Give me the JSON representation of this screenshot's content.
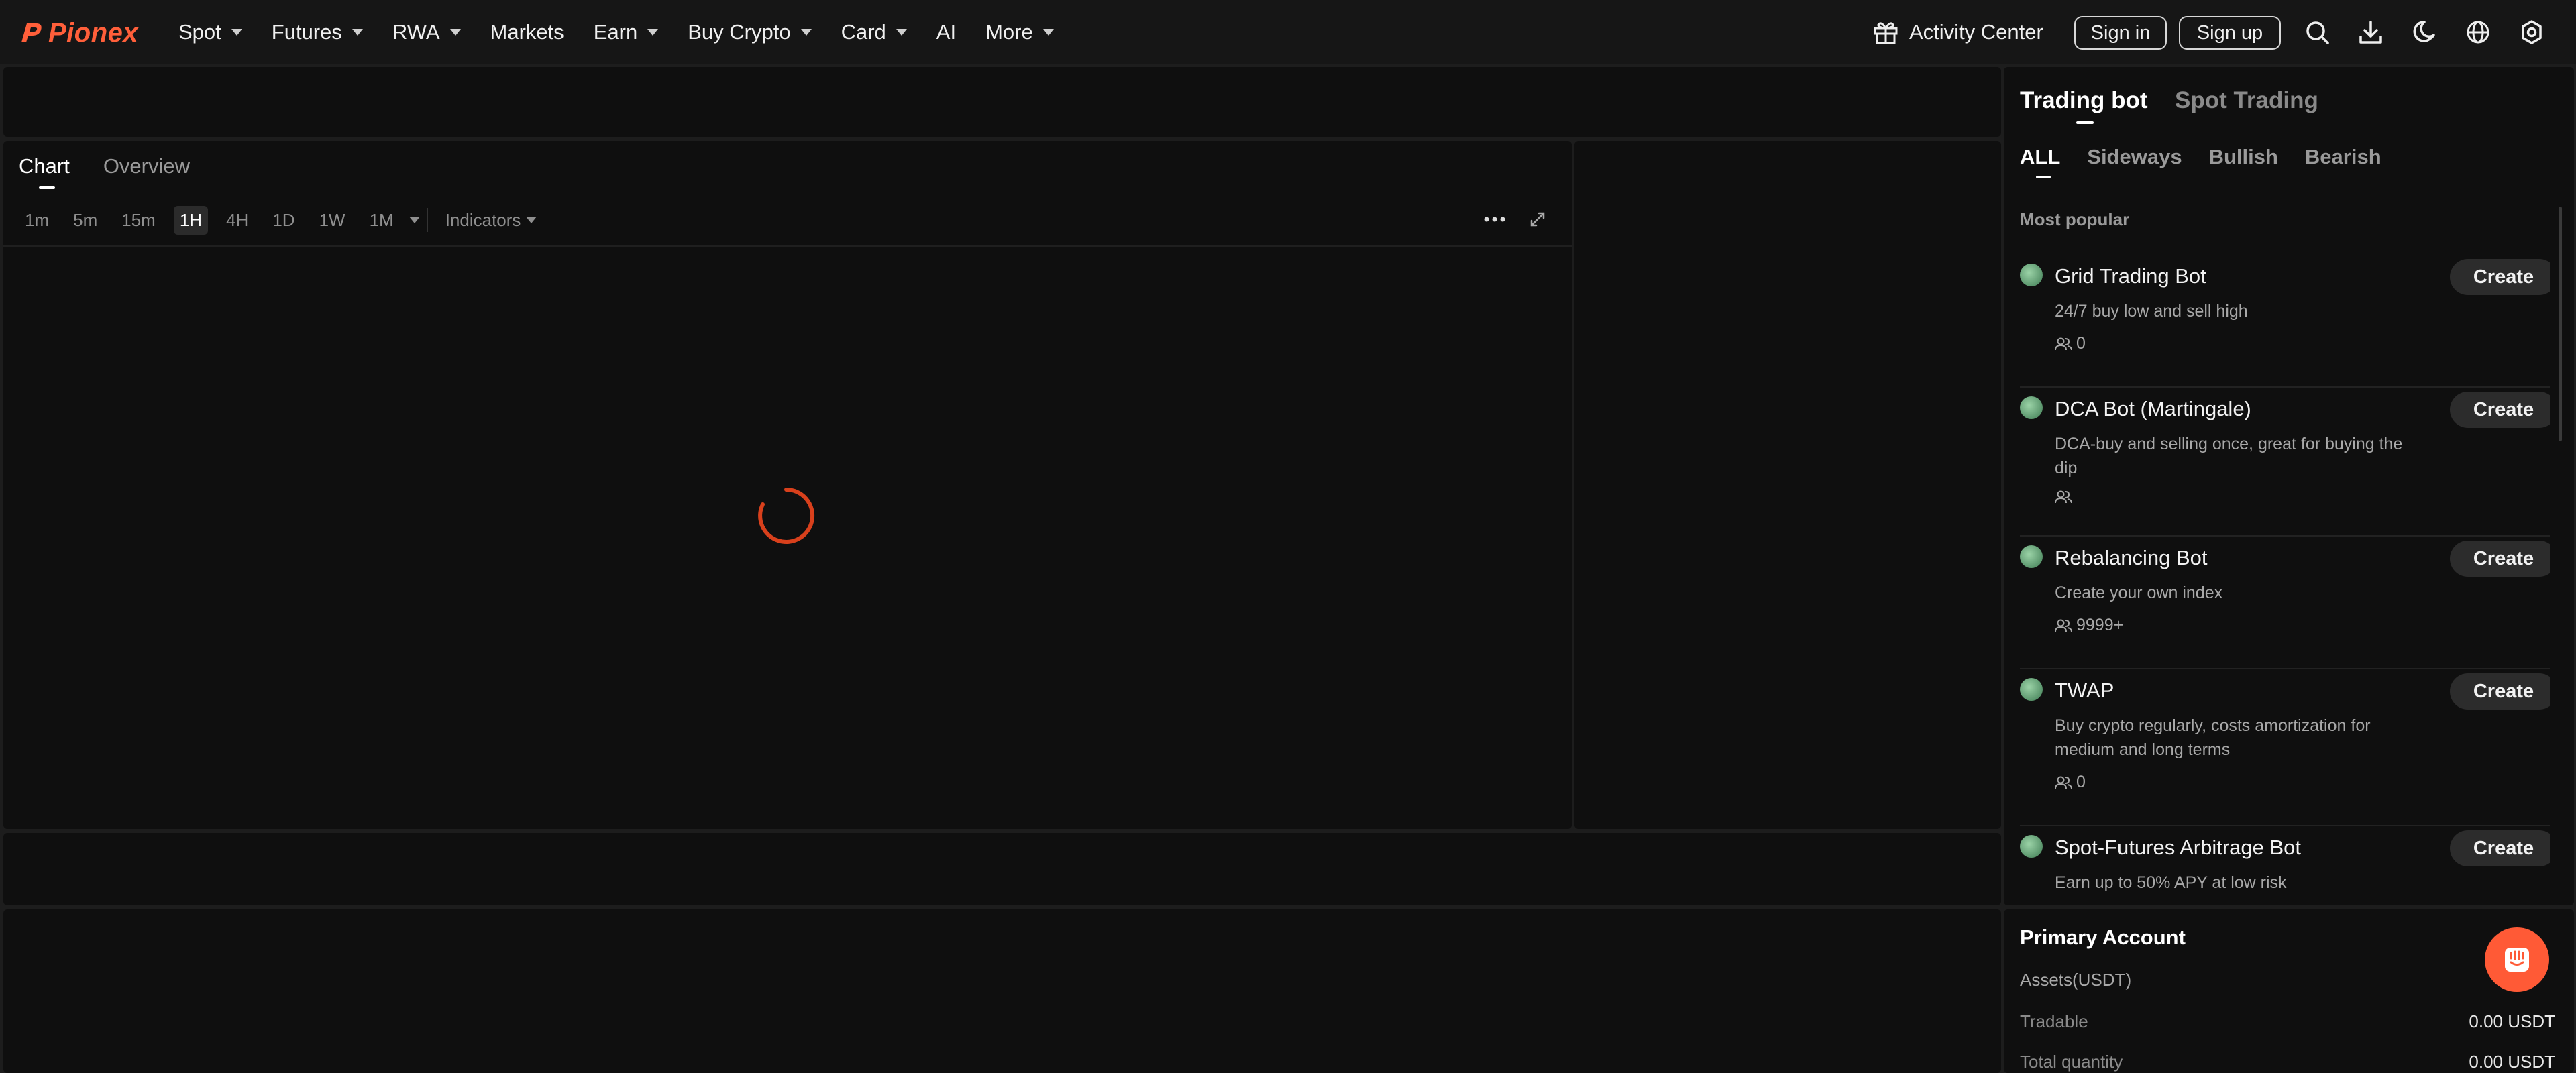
{
  "brand": {
    "name": "Pionex",
    "color": "#ff5f3a"
  },
  "nav": {
    "items": [
      {
        "label": "Spot",
        "dropdown": true
      },
      {
        "label": "Futures",
        "dropdown": true
      },
      {
        "label": "RWA",
        "dropdown": true
      },
      {
        "label": "Markets",
        "dropdown": false
      },
      {
        "label": "Earn",
        "dropdown": true
      },
      {
        "label": "Buy Crypto",
        "dropdown": true
      },
      {
        "label": "Card",
        "dropdown": true
      },
      {
        "label": "AI",
        "dropdown": false
      },
      {
        "label": "More",
        "dropdown": true
      }
    ],
    "activity_center": "Activity Center",
    "sign_in": "Sign in",
    "sign_up": "Sign up",
    "icons": [
      "search-icon",
      "download-icon",
      "moon-icon",
      "globe-icon",
      "settings-icon"
    ]
  },
  "chart_panel": {
    "tabs": [
      "Chart",
      "Overview"
    ],
    "active_tab": "Chart",
    "intervals": [
      "1m",
      "5m",
      "15m",
      "1H",
      "4H",
      "1D",
      "1W",
      "1M"
    ],
    "selected_interval": "1H",
    "indicators_label": "Indicators"
  },
  "bot_panel": {
    "tabs": [
      "Trading bot",
      "Spot Trading"
    ],
    "active_tab": "Trading bot",
    "filters": [
      "ALL",
      "Sideways",
      "Bullish",
      "Bearish"
    ],
    "active_filter": "ALL",
    "section_label": "Most popular",
    "create_label": "Create",
    "bots": [
      {
        "title": "Grid Trading Bot",
        "desc": "24/7 buy low and sell high",
        "users": "0"
      },
      {
        "title": "DCA Bot (Martingale)",
        "desc": "DCA-buy and selling once, great for buying the dip",
        "users": ""
      },
      {
        "title": "Rebalancing Bot",
        "desc": "Create your own index",
        "users": "9999+"
      },
      {
        "title": "TWAP",
        "desc": "Buy crypto regularly, costs amortization for medium and long terms",
        "users": "0"
      },
      {
        "title": "Spot-Futures Arbitrage Bot",
        "desc": "Earn up to 50% APY at low risk",
        "users": ""
      }
    ]
  },
  "account": {
    "title": "Primary Account",
    "subtitle": "Assets(USDT)",
    "rows": [
      {
        "label": "Tradable",
        "value": "0.00 USDT"
      },
      {
        "label": "Total quantity",
        "value": "0.00 USDT"
      }
    ]
  }
}
